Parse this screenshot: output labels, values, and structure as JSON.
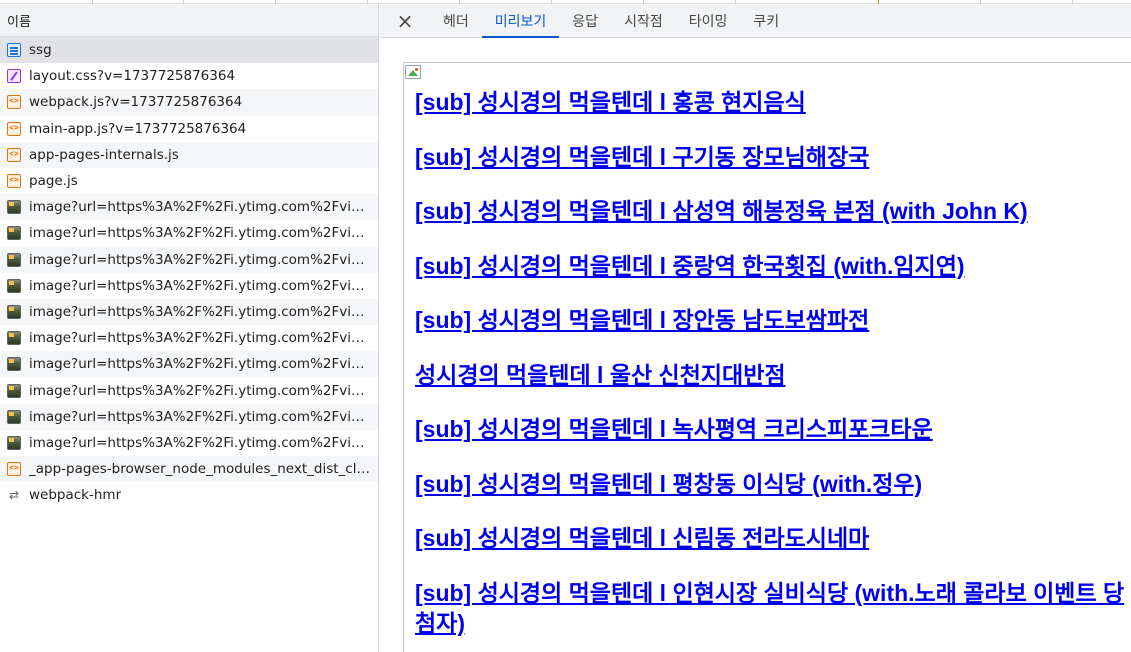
{
  "request_list": {
    "header": "이름",
    "items": [
      {
        "name": "ssg",
        "type": "doc"
      },
      {
        "name": "layout.css?v=1737725876364",
        "type": "css"
      },
      {
        "name": "webpack.js?v=1737725876364",
        "type": "js"
      },
      {
        "name": "main-app.js?v=1737725876364",
        "type": "js"
      },
      {
        "name": "app-pages-internals.js",
        "type": "js"
      },
      {
        "name": "page.js",
        "type": "js"
      },
      {
        "name": "image?url=https%3A%2F%2Fi.ytimg.com%2Fvi%...",
        "type": "img"
      },
      {
        "name": "image?url=https%3A%2F%2Fi.ytimg.com%2Fvi%...",
        "type": "img"
      },
      {
        "name": "image?url=https%3A%2F%2Fi.ytimg.com%2Fvi%...",
        "type": "img"
      },
      {
        "name": "image?url=https%3A%2F%2Fi.ytimg.com%2Fvi%...",
        "type": "img"
      },
      {
        "name": "image?url=https%3A%2F%2Fi.ytimg.com%2Fvi%...",
        "type": "img"
      },
      {
        "name": "image?url=https%3A%2F%2Fi.ytimg.com%2Fvi%...",
        "type": "img"
      },
      {
        "name": "image?url=https%3A%2F%2Fi.ytimg.com%2Fvi%...",
        "type": "img"
      },
      {
        "name": "image?url=https%3A%2F%2Fi.ytimg.com%2Fvi%...",
        "type": "img"
      },
      {
        "name": "image?url=https%3A%2F%2Fi.ytimg.com%2Fvi%...",
        "type": "img"
      },
      {
        "name": "image?url=https%3A%2F%2Fi.ytimg.com%2Fvi%...",
        "type": "img"
      },
      {
        "name": "_app-pages-browser_node_modules_next_dist_cli...",
        "type": "js"
      },
      {
        "name": "webpack-hmr",
        "type": "ws"
      }
    ]
  },
  "detail_tabs": {
    "close_icon": "×",
    "tabs": [
      "헤더",
      "미리보기",
      "응답",
      "시작점",
      "타이밍",
      "쿠키"
    ],
    "active": "미리보기"
  },
  "preview": {
    "links": [
      "[sub] 성시경의 먹을텐데 l 홍콩 현지음식",
      "[sub] 성시경의 먹을텐데 l 구기동 장모님해장국",
      "[sub] 성시경의 먹을텐데 l 삼성역 해봉정육 본점 (with John K)",
      "[sub] 성시경의 먹을텐데 l 중랑역 한국횟집 (with.임지연)",
      "[sub] 성시경의 먹을텐데 l 장안동 남도보쌈파전",
      "성시경의 먹을텐데 l 울산 신천지대반점",
      "[sub] 성시경의 먹을텐데 l 녹사평역 크리스피포크타운",
      "[sub] 성시경의 먹을텐데 l 평창동 이식당 (with.정우)",
      "[sub] 성시경의 먹을텐데 l 신림동 전라도시네마",
      "[sub] 성시경의 먹을텐데 l 인현시장 실비식당 (with.노래 콜라보 이벤트 당첨자)"
    ]
  },
  "colors": {
    "link": "#0000ee",
    "active_tab": "#0b57d0",
    "selected_row": "#e1e2e5"
  }
}
